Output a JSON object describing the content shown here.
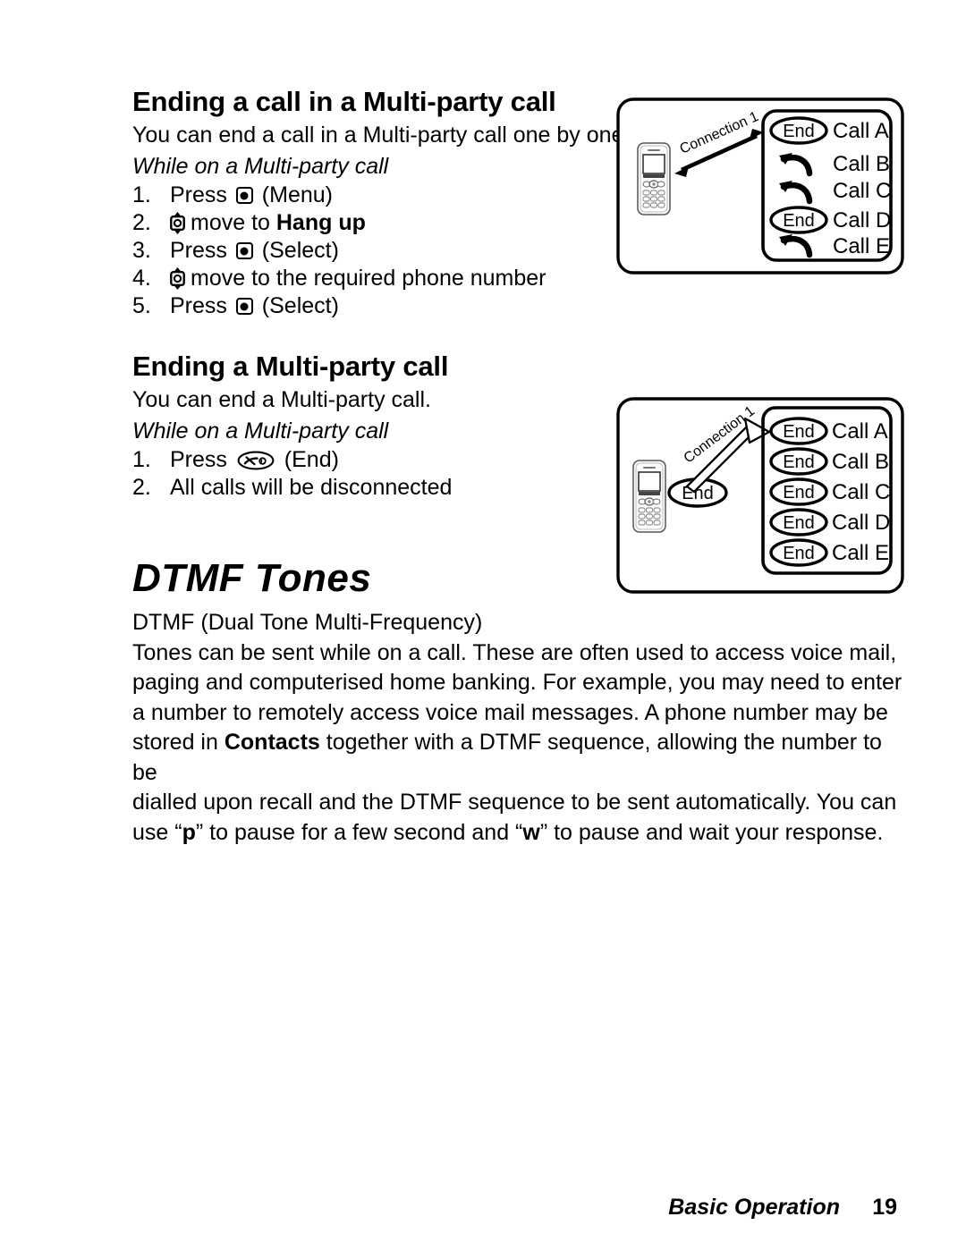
{
  "document": {
    "page_number": "19",
    "chapter_name": "Basic Operation"
  },
  "sections": [
    {
      "title": "Ending a call in a Multi-party call",
      "intro": "You can end a call in a Multi-party call one by one.",
      "condition": "While on a Multi-party call",
      "steps": [
        {
          "num": "1.",
          "pre": "Press ",
          "icon": "select-key-icon",
          "post": " (Menu)"
        },
        {
          "num": "2.",
          "pre": "",
          "icon": "navigation-key-icon",
          "post": "move to ",
          "bold": "Hang up"
        },
        {
          "num": "3.",
          "pre": "Press ",
          "icon": "select-key-icon",
          "post": " (Select)"
        },
        {
          "num": "4.",
          "pre": "",
          "icon": "navigation-key-icon",
          "post": "move to the required phone number"
        },
        {
          "num": "5.",
          "pre": "Press ",
          "icon": "select-key-icon",
          "post": " (Select)"
        }
      ]
    },
    {
      "title": "Ending a Multi-party call",
      "intro": "You can end a Multi-party call.",
      "condition": "While on a Multi-party call",
      "steps": [
        {
          "num": "1.",
          "pre": "Press ",
          "icon": "end-key-icon",
          "post": " (End)"
        },
        {
          "num": "2.",
          "pre": "All calls will be disconnected",
          "icon": "",
          "post": ""
        }
      ]
    }
  ],
  "chapter": {
    "title": "DTMF Tones",
    "abbrev_line": "DTMF (Dual Tone Multi-Frequency)",
    "paragraph_lines": [
      "Tones can be sent while on a call. These are often used to access voice mail,",
      "paging and computerised home banking. For example, you may need to enter",
      "a number to remotely access voice mail messages. A phone number may be",
      "stored in |Contacts| together with a DTMF sequence, allowing the number to be",
      "dialled upon recall and the DTMF sequence to be sent automatically. You can",
      "use “|p|” to pause for a few second and “|w|” to pause and wait your response."
    ]
  },
  "diagrams": [
    {
      "id": "ending-one-call-diagram",
      "connection_label": "Connection 1",
      "arrow_style": "double-headed-solid",
      "phone_end_label": "",
      "calls": [
        {
          "label": "Call A",
          "marker": "End"
        },
        {
          "label": "Call B",
          "marker": "arrow"
        },
        {
          "label": "Call C",
          "marker": "arrow"
        },
        {
          "label": "Call D",
          "marker": "End"
        },
        {
          "label": "Call E",
          "marker": "arrow"
        }
      ]
    },
    {
      "id": "ending-multiparty-diagram",
      "connection_label": "Connection 1",
      "arrow_style": "single-headed-outline",
      "phone_end_label": "End",
      "calls": [
        {
          "label": "Call A",
          "marker": "End"
        },
        {
          "label": "Call B",
          "marker": "End"
        },
        {
          "label": "Call C",
          "marker": "End"
        },
        {
          "label": "Call D",
          "marker": "End"
        },
        {
          "label": "Call E",
          "marker": "End"
        }
      ]
    }
  ]
}
